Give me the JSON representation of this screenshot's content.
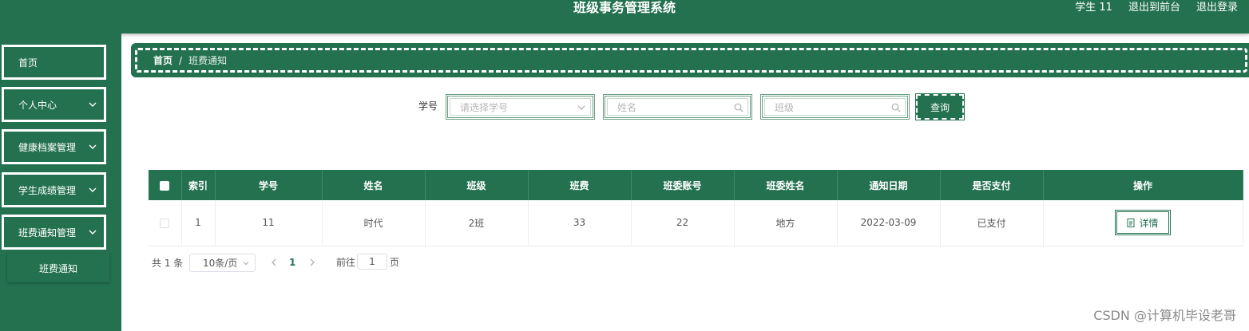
{
  "header": {
    "title": "班级事务管理系统",
    "user": "学生 11",
    "back_to_front": "退出到前台",
    "logout": "退出登录"
  },
  "sidebar": {
    "items": [
      {
        "label": "首页"
      },
      {
        "label": "个人中心"
      },
      {
        "label": "健康档案管理"
      },
      {
        "label": "学生成绩管理"
      },
      {
        "label": "班费通知管理"
      }
    ],
    "subitem": "班费通知"
  },
  "breadcrumb": {
    "home": "首页",
    "separator": "/",
    "current": "班费通知"
  },
  "search": {
    "student_id_label": "学号",
    "student_id_placeholder": "请选择学号",
    "name_placeholder": "姓名",
    "class_placeholder": "班级",
    "query_button": "查询"
  },
  "table": {
    "columns": [
      "索引",
      "学号",
      "姓名",
      "班级",
      "班费",
      "班委账号",
      "班委姓名",
      "通知日期",
      "是否支付",
      "操作"
    ],
    "rows": [
      {
        "index": "1",
        "student_id": "11",
        "name": "时代",
        "class": "2班",
        "fee": "33",
        "monitor_account": "22",
        "monitor_name": "地方",
        "notice_date": "2022-03-09",
        "paid": "已支付",
        "action": "详情"
      }
    ]
  },
  "pagination": {
    "total": "共 1 条",
    "page_size": "10条/页",
    "current_page": "1",
    "goto_label": "前往",
    "goto_value": "1",
    "goto_suffix": "页"
  },
  "watermark": "CSDN @计算机毕设老哥",
  "colors": {
    "primary": "#23714f",
    "white": "#ffffff"
  }
}
